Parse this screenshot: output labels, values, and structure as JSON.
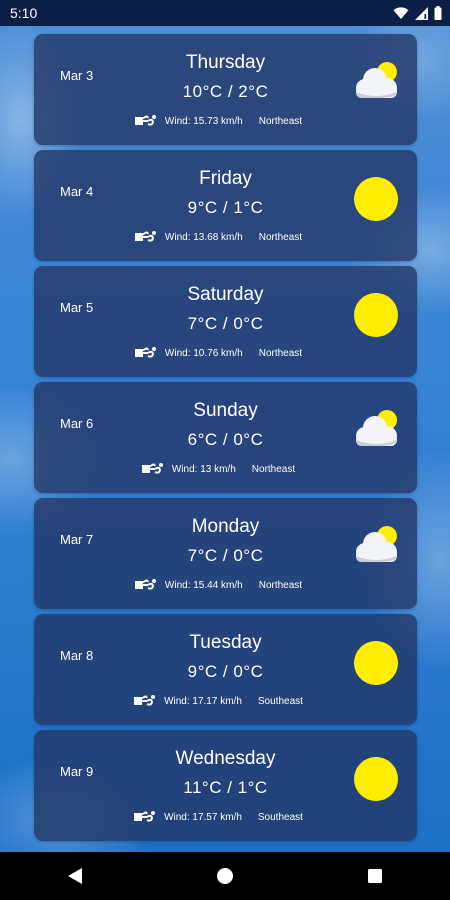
{
  "status_bar": {
    "time": "5:10",
    "icons": [
      "wifi-icon",
      "signal-icon",
      "battery-icon"
    ]
  },
  "colors": {
    "card_bg": "#22346480",
    "sun": "#ffee00",
    "sky": "#2b7bd0"
  },
  "forecast": [
    {
      "date": "Mar 3",
      "day": "Thursday",
      "temp": "10°C / 2°C",
      "wind": "Wind: 15.73 km/h",
      "direction": "Northeast",
      "icon": "partly-cloudy-icon"
    },
    {
      "date": "Mar 4",
      "day": "Friday",
      "temp": "9°C / 1°C",
      "wind": "Wind: 13.68 km/h",
      "direction": "Northeast",
      "icon": "sun-icon"
    },
    {
      "date": "Mar 5",
      "day": "Saturday",
      "temp": "7°C / 0°C",
      "wind": "Wind: 10.76 km/h",
      "direction": "Northeast",
      "icon": "sun-icon"
    },
    {
      "date": "Mar 6",
      "day": "Sunday",
      "temp": "6°C / 0°C",
      "wind": "Wind: 13 km/h",
      "direction": "Northeast",
      "icon": "partly-cloudy-icon"
    },
    {
      "date": "Mar 7",
      "day": "Monday",
      "temp": "7°C / 0°C",
      "wind": "Wind: 15.44 km/h",
      "direction": "Northeast",
      "icon": "partly-cloudy-icon"
    },
    {
      "date": "Mar 8",
      "day": "Tuesday",
      "temp": "9°C / 0°C",
      "wind": "Wind: 17.17 km/h",
      "direction": "Southeast",
      "icon": "sun-icon"
    },
    {
      "date": "Mar 9",
      "day": "Wednesday",
      "temp": "11°C / 1°C",
      "wind": "Wind: 17.57 km/h",
      "direction": "Southeast",
      "icon": "sun-icon"
    }
  ],
  "nav_bar": {
    "buttons": [
      "back-icon",
      "home-icon",
      "recents-icon"
    ]
  }
}
